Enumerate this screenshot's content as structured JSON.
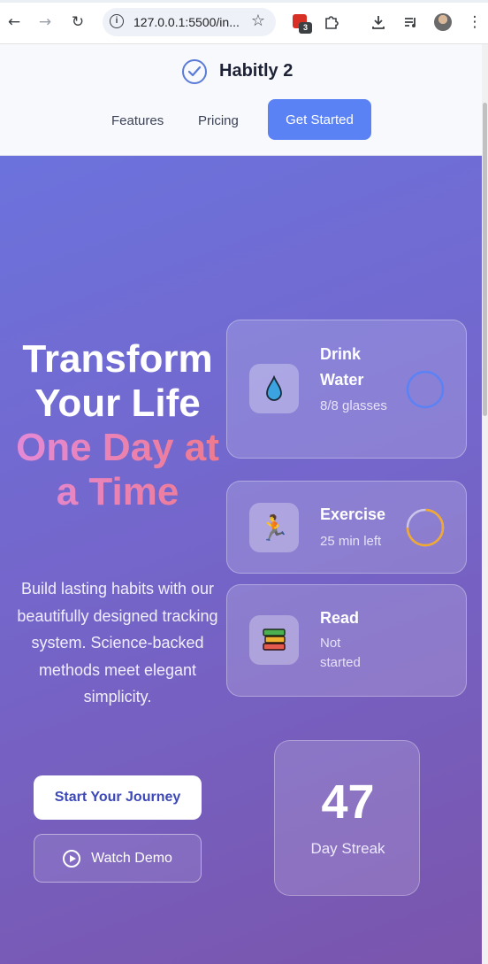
{
  "browser": {
    "url": "127.0.0.1:5500/in...",
    "extension_badge": "3"
  },
  "nav": {
    "brand": "Habitly 2",
    "links": [
      "Features",
      "Pricing"
    ],
    "cta": "Get Started"
  },
  "hero": {
    "headline_white": "Transform Your Life",
    "headline_accent": "One Day at a Time",
    "subtitle": "Build lasting habits with our beautifully designed tracking system. Science-backed methods meet elegant simplicity.",
    "primary_button": "Start Your Journey",
    "secondary_button": "Watch Demo"
  },
  "habits": [
    {
      "icon": "water-drop-icon",
      "title": "Drink Water",
      "status": "8/8 glasses",
      "progress": 1.0,
      "ring_color": "#5b82f5"
    },
    {
      "icon": "running-person-icon",
      "title": "Exercise",
      "status": "25 min left",
      "progress": 0.75,
      "ring_color": "#f0a830"
    },
    {
      "icon": "books-icon",
      "title": "Read",
      "status": "Not started",
      "progress": 0
    }
  ],
  "streak": {
    "value": "47",
    "label": "Day Streak"
  },
  "colors": {
    "accent_blue": "#5b82f5",
    "hero_start": "#6c72dc",
    "hero_end": "#7a55ad",
    "headline_gradient_start": "#e48ad8",
    "headline_gradient_end": "#f07a8c"
  }
}
